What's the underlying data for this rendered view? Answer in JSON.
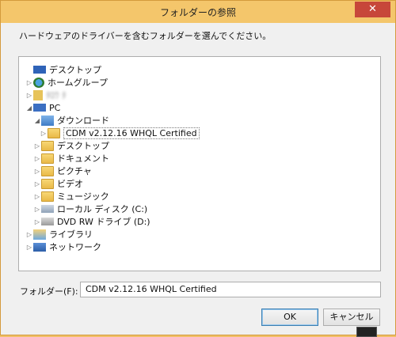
{
  "window": {
    "title": "フォルダーの参照",
    "close": "✕"
  },
  "instruction": "ハードウェアのドライバーを含むフォルダーを選んでください。",
  "tree": [
    {
      "label": "デスクトップ",
      "icon": "desktop-icon",
      "arrow": ""
    },
    {
      "label": "ホームグループ",
      "icon": "homegroup-icon",
      "arrow": "▷"
    },
    {
      "label": "ﾀﾛｳ ﾀ",
      "icon": "user-icon",
      "arrow": "▷"
    },
    {
      "label": "PC",
      "icon": "pc-icon",
      "arrow": "◢"
    },
    {
      "label": "ダウンロード",
      "icon": "downloads-folder-icon",
      "arrow": "◢"
    },
    {
      "label": "CDM v2.12.16 WHQL Certified",
      "icon": "folder-icon",
      "arrow": "▷"
    },
    {
      "label": "デスクトップ",
      "icon": "folder-icon",
      "arrow": "▷"
    },
    {
      "label": "ドキュメント",
      "icon": "folder-icon",
      "arrow": "▷"
    },
    {
      "label": "ピクチャ",
      "icon": "folder-icon",
      "arrow": "▷"
    },
    {
      "label": "ビデオ",
      "icon": "folder-icon",
      "arrow": "▷"
    },
    {
      "label": "ミュージック",
      "icon": "folder-icon",
      "arrow": "▷"
    },
    {
      "label": "ローカル ディスク (C:)",
      "icon": "drive-icon",
      "arrow": "▷"
    },
    {
      "label": "DVD RW ドライブ (D:)",
      "icon": "dvd-icon",
      "arrow": "▷"
    },
    {
      "label": "ライブラリ",
      "icon": "library-icon",
      "arrow": "▷"
    },
    {
      "label": "ネットワーク",
      "icon": "network-icon",
      "arrow": "▷"
    }
  ],
  "folder": {
    "label": "フォルダー(F):",
    "value": "CDM v2.12.16 WHQL Certified"
  },
  "buttons": {
    "ok": "OK",
    "cancel": "キャンセル"
  }
}
